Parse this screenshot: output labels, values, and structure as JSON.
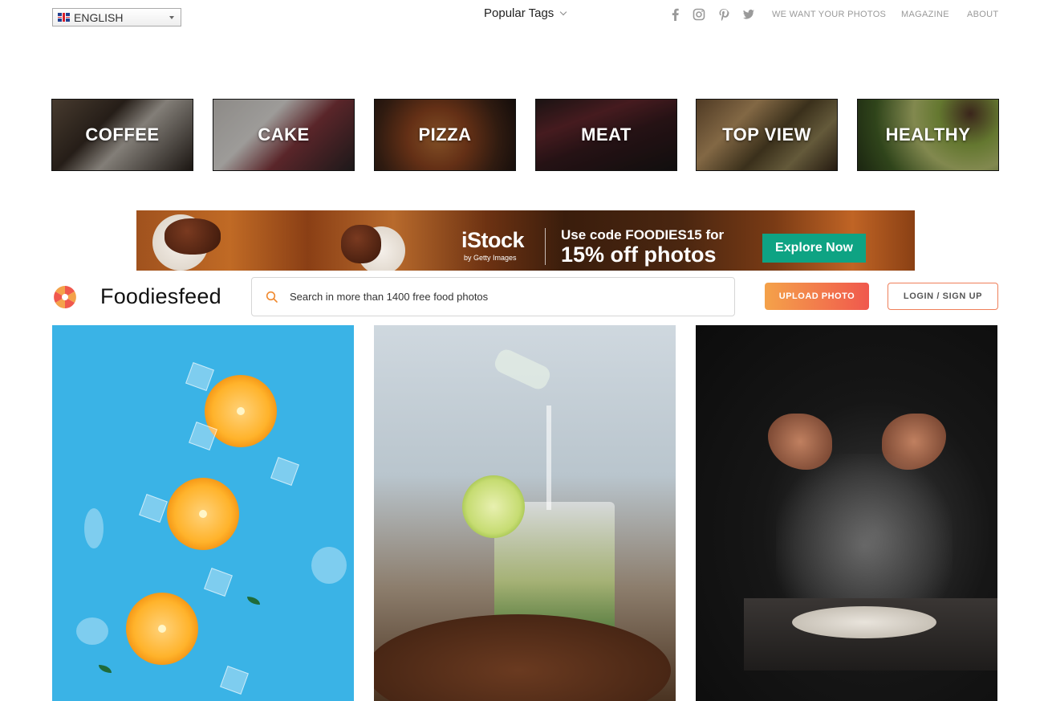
{
  "language": {
    "selected": "ENGLISH"
  },
  "popular_tags": {
    "label": "Popular Tags"
  },
  "social": [
    "facebook-icon",
    "instagram-icon",
    "pinterest-icon",
    "twitter-icon"
  ],
  "nav": {
    "want_photos": "WE WANT YOUR PHOTOS",
    "magazine": "MAGAZINE",
    "about": "ABOUT"
  },
  "categories": [
    "COFFEE",
    "CAKE",
    "PIZZA",
    "MEAT",
    "TOP VIEW",
    "HEALTHY"
  ],
  "banner": {
    "brand": "iStock",
    "sub": "by Getty Images",
    "line1": "Use code FOODIES15 for",
    "line2": "15% off photos",
    "cta": "Explore Now"
  },
  "header": {
    "brand": "Foodiesfeed",
    "search_placeholder": "Search in more than 1400 free food photos",
    "upload": "UPLOAD PHOTO",
    "login": "LOGIN / SIGN UP"
  },
  "colors": {
    "accent_orange": "#f4a24a",
    "accent_red": "#f0584d",
    "cta_green": "#0ea383",
    "photo_blue": "#3ab3e6"
  }
}
